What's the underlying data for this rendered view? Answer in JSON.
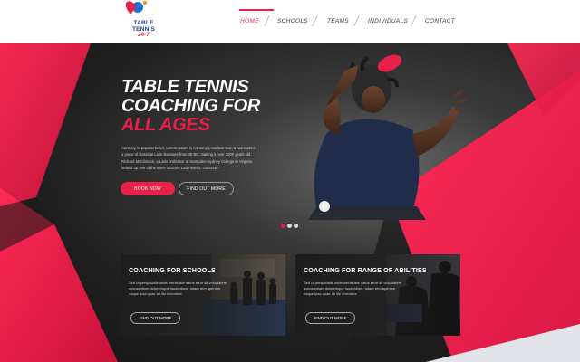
{
  "logo": {
    "line1": "TABLE",
    "line2": "TENNIS",
    "line3": "24-7"
  },
  "nav": {
    "items": [
      {
        "label": "HOME",
        "active": true
      },
      {
        "label": "SCHOOLS",
        "active": false
      },
      {
        "label": "TEAMS",
        "active": false
      },
      {
        "label": "INDIVIDUALS",
        "active": false
      },
      {
        "label": "CONTACT",
        "active": false
      }
    ]
  },
  "hero": {
    "title_line1": "TABLE TENNIS",
    "title_line2": "COACHING FOR",
    "title_accent": "ALL AGES",
    "body": "Contrary to popular belief, Lorem Ipsum is not simply random text. It has roots in a piece of classical Latin literature from 45 BC, making it over 2000 years old. Richard McClintock, a Latin professor at Hampden-Sydney College in Virginia, looked up one of the more obscure Latin words, consecte-",
    "book_label": "BOOK NOW",
    "find_label": "FIND OUT MORE",
    "slides": 3,
    "active_slide": 1
  },
  "cards": [
    {
      "title": "COACHING FOR SCHOOLS",
      "text": "Sed ut perspiciatis unde omnis iste natus error sit voluptatem accusantium doloremque laudantium, totam rem aperiam, eaque ipsa quae ab illo inventore",
      "button": "FIND OUT MORE"
    },
    {
      "title": "COACHING FOR RANGE OF ABILITIES",
      "text": "Sed ut perspiciatis unde omnis iste natus error sit voluptatem accusantium doloremque laudantium, totam rem aperiam, eaque ipsa quae ab illo inventore",
      "button": "FIND OUT MORE"
    }
  ],
  "colors": {
    "accent": "#e8214a",
    "dark": "#1a1a1a",
    "logo_blue": "#1f3a8a"
  }
}
